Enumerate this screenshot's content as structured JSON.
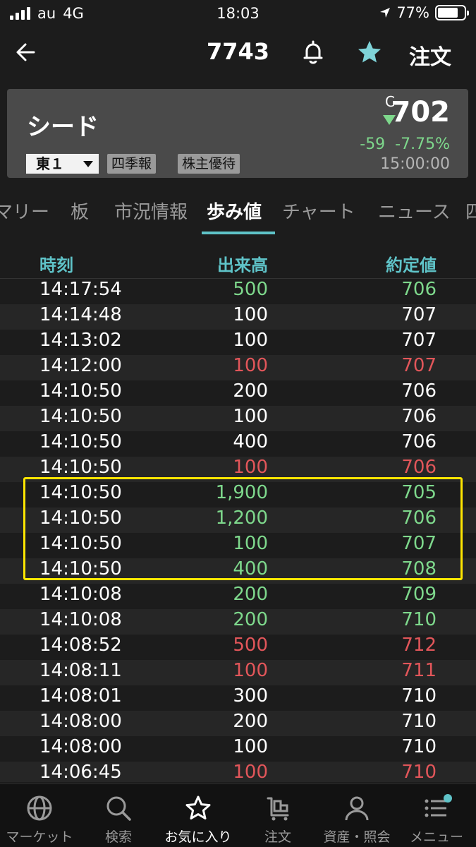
{
  "status_bar": {
    "carrier": "au",
    "network": "4G",
    "time": "18:03",
    "battery": "77%",
    "battery_level": 0.77
  },
  "nav": {
    "title": "7743",
    "order_label": "注文",
    "back_icon": "back-arrow-icon",
    "bell_icon": "bell-icon",
    "star_icon": "star-icon",
    "star_color": "#7fd3d8"
  },
  "stock": {
    "name": "シード",
    "market": "東１",
    "tags": [
      "四季報",
      "株主優待"
    ],
    "price_flag": "C",
    "price": "702",
    "change": "-59  -7.75%",
    "time": "15:00:00",
    "down_color": "#7ed88c"
  },
  "tabs": [
    {
      "label": "マリー"
    },
    {
      "label": "板"
    },
    {
      "label": "市況情報"
    },
    {
      "label": "歩み値",
      "active": true
    },
    {
      "label": "チャート"
    },
    {
      "label": "ニュース"
    },
    {
      "label": "四"
    }
  ],
  "table": {
    "headers": {
      "time": "時刻",
      "volume": "出来高",
      "price": "約定値"
    },
    "rows": [
      {
        "time": "14:17:54",
        "volume": "500",
        "vcolor": "green",
        "price": "706",
        "pcolor": "green"
      },
      {
        "time": "14:14:48",
        "volume": "100",
        "vcolor": "white",
        "price": "707",
        "pcolor": "white"
      },
      {
        "time": "14:13:02",
        "volume": "100",
        "vcolor": "white",
        "price": "707",
        "pcolor": "white"
      },
      {
        "time": "14:12:00",
        "volume": "100",
        "vcolor": "red",
        "price": "707",
        "pcolor": "red"
      },
      {
        "time": "14:10:50",
        "volume": "200",
        "vcolor": "white",
        "price": "706",
        "pcolor": "white"
      },
      {
        "time": "14:10:50",
        "volume": "100",
        "vcolor": "white",
        "price": "706",
        "pcolor": "white"
      },
      {
        "time": "14:10:50",
        "volume": "400",
        "vcolor": "white",
        "price": "706",
        "pcolor": "white"
      },
      {
        "time": "14:10:50",
        "volume": "100",
        "vcolor": "red",
        "price": "706",
        "pcolor": "red"
      },
      {
        "time": "14:10:50",
        "volume": "1,900",
        "vcolor": "green",
        "price": "705",
        "pcolor": "green"
      },
      {
        "time": "14:10:50",
        "volume": "1,200",
        "vcolor": "green",
        "price": "706",
        "pcolor": "green"
      },
      {
        "time": "14:10:50",
        "volume": "100",
        "vcolor": "green",
        "price": "707",
        "pcolor": "green"
      },
      {
        "time": "14:10:50",
        "volume": "400",
        "vcolor": "green",
        "price": "708",
        "pcolor": "green"
      },
      {
        "time": "14:10:08",
        "volume": "200",
        "vcolor": "green",
        "price": "709",
        "pcolor": "green"
      },
      {
        "time": "14:10:08",
        "volume": "200",
        "vcolor": "green",
        "price": "710",
        "pcolor": "green"
      },
      {
        "time": "14:08:52",
        "volume": "500",
        "vcolor": "red",
        "price": "712",
        "pcolor": "red"
      },
      {
        "time": "14:08:11",
        "volume": "100",
        "vcolor": "red",
        "price": "711",
        "pcolor": "red"
      },
      {
        "time": "14:08:01",
        "volume": "300",
        "vcolor": "white",
        "price": "710",
        "pcolor": "white"
      },
      {
        "time": "14:08:00",
        "volume": "200",
        "vcolor": "white",
        "price": "710",
        "pcolor": "white"
      },
      {
        "time": "14:08:00",
        "volume": "100",
        "vcolor": "white",
        "price": "710",
        "pcolor": "white"
      },
      {
        "time": "14:06:45",
        "volume": "100",
        "vcolor": "red",
        "price": "710",
        "pcolor": "red"
      }
    ]
  },
  "colors": {
    "accent": "#5fc3c8",
    "up": "#7ed88c",
    "down": "#e2565a",
    "highlight": "#ffe600"
  },
  "tab_bar": [
    {
      "label": "マーケット",
      "icon": "globe-icon"
    },
    {
      "label": "検索",
      "icon": "search-icon"
    },
    {
      "label": "お気に入り",
      "icon": "star-outline-icon",
      "active": true
    },
    {
      "label": "注文",
      "icon": "cart-icon"
    },
    {
      "label": "資産・照会",
      "icon": "person-icon"
    },
    {
      "label": "メニュー",
      "icon": "menu-icon"
    }
  ]
}
